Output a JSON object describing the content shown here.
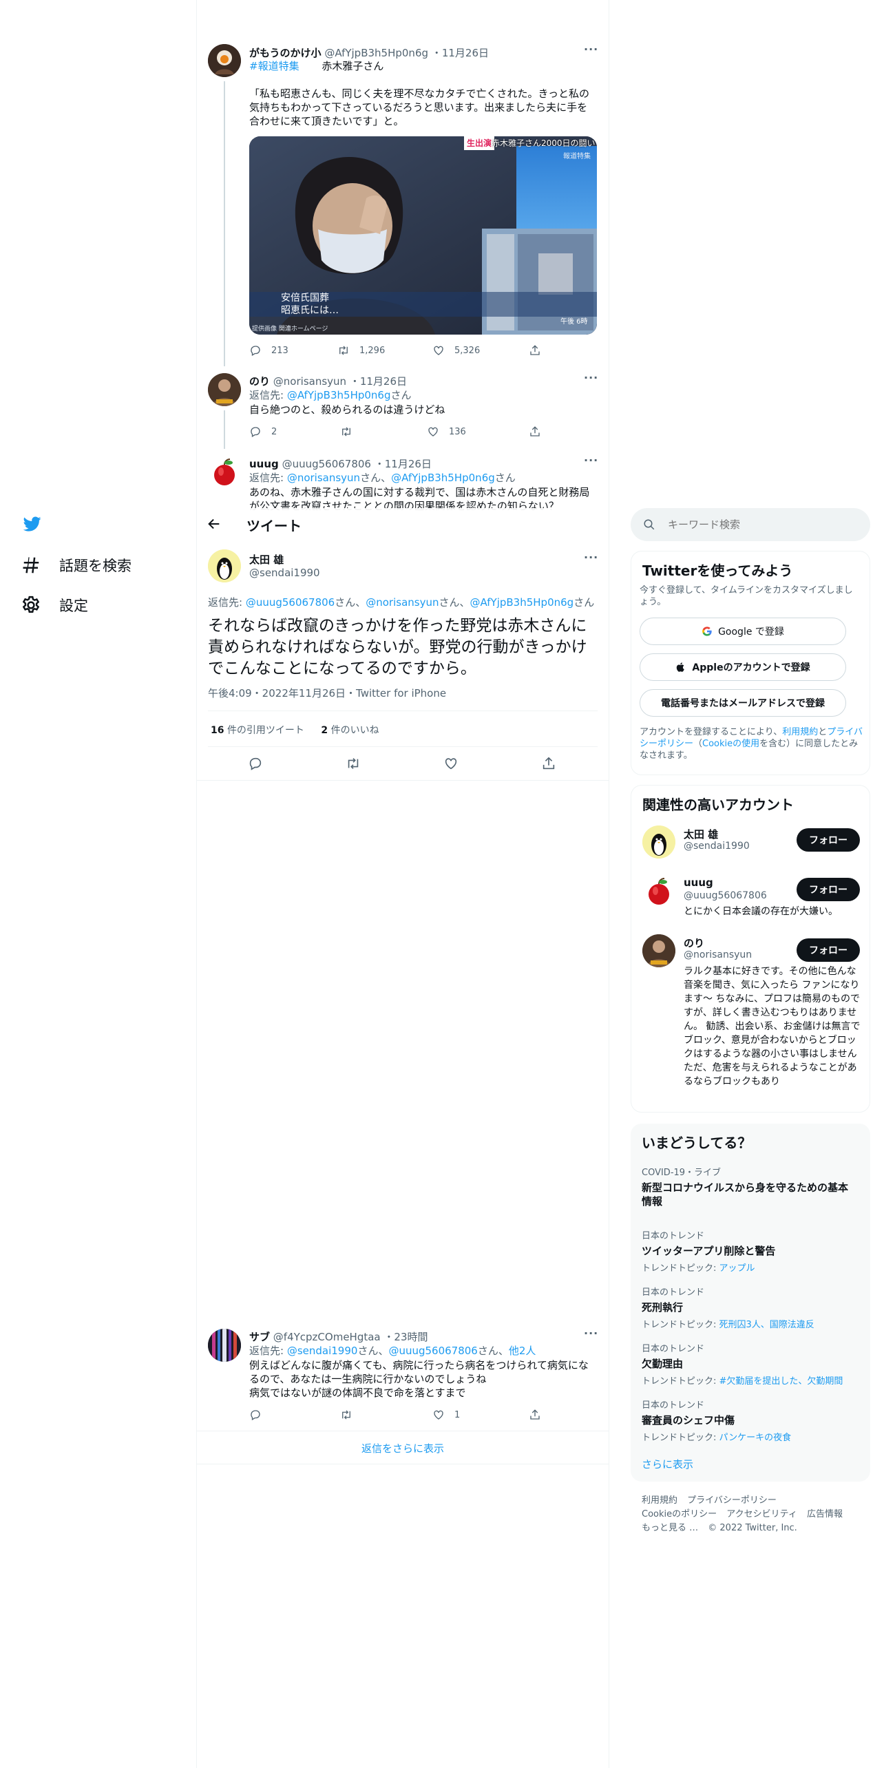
{
  "nav": {
    "explore_label": "話題を検索",
    "settings_label": "設定"
  },
  "header": {
    "title": "ツイート"
  },
  "context_tweets": [
    {
      "name": "がもうのかけ小",
      "handle": "@AfYjpB3h5Hp0n6g",
      "date": "11月26日",
      "hashtag": "#報道特集",
      "hashtag_extra": "赤木雅子さん",
      "text": "「私も昭恵さんも、同じく夫を理不尽なカタチで亡くされた。きっと私の気持ちもわかって下さっているだろうと思います。出来ましたら夫に手を合わせに来て頂きたいです」と。",
      "media": {
        "badge": "生出演",
        "banner": "赤木雅子さん2000日の闘い",
        "program": "報道特集",
        "caption_line1": "安倍氏国葬",
        "caption_line2": "昭恵氏には…",
        "footer": "提供画像 関連ホームページ",
        "time": "午後 6時"
      },
      "replies": "213",
      "retweets": "1,296",
      "likes": "5,326"
    },
    {
      "name": "のり",
      "handle": "@norisansyun",
      "date": "11月26日",
      "reply_prefix": "返信先: ",
      "reply_to": "@AfYjpB3h5Hp0n6g",
      "reply_suffix": "さん",
      "text": "自ら絶つのと、殺められるのは違うけどね",
      "replies": "2",
      "retweets": "",
      "likes": "136"
    },
    {
      "name": "uuug",
      "handle": "@uuug56067806",
      "date": "11月26日",
      "reply_prefix": "返信先: ",
      "reply_to_1": "@norisansyun",
      "reply_mid": "さん、",
      "reply_to_2": "@AfYjpB3h5Hp0n6g",
      "reply_suffix": "さん",
      "text": "あのね、赤木雅子さんの国に対する裁判で、国は赤木さんの自死と財務局が公文書を改竄させたこととの間の因果関係を認めたの知らない？"
    }
  ],
  "main_tweet": {
    "name": "太田 雄",
    "handle": "@sendai1990",
    "reply_prefix": "返信先: ",
    "reply_to_1": "@uuug56067806",
    "reply_to_2": "@norisansyun",
    "reply_to_3": "@AfYjpB3h5Hp0n6g",
    "san": "さん",
    "sep": "、",
    "text": "それならば改竄のきっかけを作った野党は赤木さんに責められなければならないが。野党の行動がきっかけでこんなことになってるのですから。",
    "meta": "午後4:09・2022年11月26日・Twitter for iPhone",
    "quote_count": "16",
    "quote_label": "件の引用ツイート",
    "like_count": "2",
    "like_label": "件のいいね"
  },
  "reply_tweet": {
    "name": "サブ",
    "handle": "@f4YcpzCOmeHgtaa",
    "date": "23時間",
    "reply_prefix": "返信先: ",
    "reply_to_1": "@sendai1990",
    "reply_mid": "さん、",
    "reply_to_2": "@uuug56067806",
    "reply_mid2": "さん、",
    "reply_more": "他2人",
    "text1": "例えばどんなに腹が痛くても、病院に行ったら病名をつけられて病気になるので、あなたは一生病院に行かないのでしょうね",
    "text2": "病気ではないが謎の体調不良で命を落とすまで",
    "likes": "1"
  },
  "show_more_replies": "返信をさらに表示",
  "search": {
    "placeholder": "キーワード検索"
  },
  "signup": {
    "title": "Twitterを使ってみよう",
    "desc": "今すぐ登録して、タイムラインをカスタマイズしましょう。",
    "google": "Google で登録",
    "apple": "Appleのアカウントで登録",
    "phone": "電話番号またはメールアドレスで登録",
    "terms_1": "アカウントを登録することにより、",
    "terms_link_1": "利用規約",
    "terms_2": "と",
    "terms_link_2": "プライバシーポリシー",
    "terms_3": "（",
    "terms_link_3": "Cookieの使用",
    "terms_4": "を含む）に同意したとみなされます。"
  },
  "related": {
    "title": "関連性の高いアカウント",
    "follow_label": "フォロー",
    "accounts": [
      {
        "name": "太田 雄",
        "handle": "@sendai1990",
        "bio": ""
      },
      {
        "name": "uuug",
        "handle": "@uuug56067806",
        "bio": "とにかく日本会議の存在が大嫌い。"
      },
      {
        "name": "のり",
        "handle": "@norisansyun",
        "bio": "ラルク基本に好きです。その他に色んな音楽を聞き、気に入ったら ファンになります～ ちなみに、プロフは簡易のものですが、詳しく書き込むつもりはありません。 勧誘、出会い系、お金儲けは無言でブロック、意見が合わないからとブロックはするような器の小さい事はしません ただ、危害を与えられるようなことがあるならブロックもあり"
      }
    ]
  },
  "trends": {
    "title": "いまどうしてる？",
    "items": [
      {
        "context": "COVID-19・ライブ",
        "title": "新型コロナウイルスから身を守るための基本情報",
        "sub_prefix": "",
        "sub_link": ""
      },
      {
        "context": "日本のトレンド",
        "title": "ツイッターアプリ削除と警告",
        "sub_prefix": "トレンドトピック: ",
        "sub_link": "アップル"
      },
      {
        "context": "日本のトレンド",
        "title": "死刑執行",
        "sub_prefix": "トレンドトピック: ",
        "sub_link": "死刑囚3人、国際法違反"
      },
      {
        "context": "日本のトレンド",
        "title": "欠勤理由",
        "sub_prefix": "トレンドトピック: ",
        "sub_link": "#欠勤届を提出した、欠勤期間"
      },
      {
        "context": "日本のトレンド",
        "title": "審査員のシェフ中傷",
        "sub_prefix": "トレンドトピック: ",
        "sub_link": "パンケーキの夜食"
      }
    ],
    "show_more": "さらに表示"
  },
  "footer": {
    "links": [
      "利用規約",
      "プライバシーポリシー",
      "Cookieのポリシー",
      "アクセシビリティ",
      "広告情報",
      "もっと見る …"
    ],
    "copyright": "© 2022 Twitter, Inc."
  },
  "colors": {
    "accent": "#1d9bf0",
    "text": "#0f1419",
    "muted": "#536471",
    "border": "#eff3f4"
  }
}
